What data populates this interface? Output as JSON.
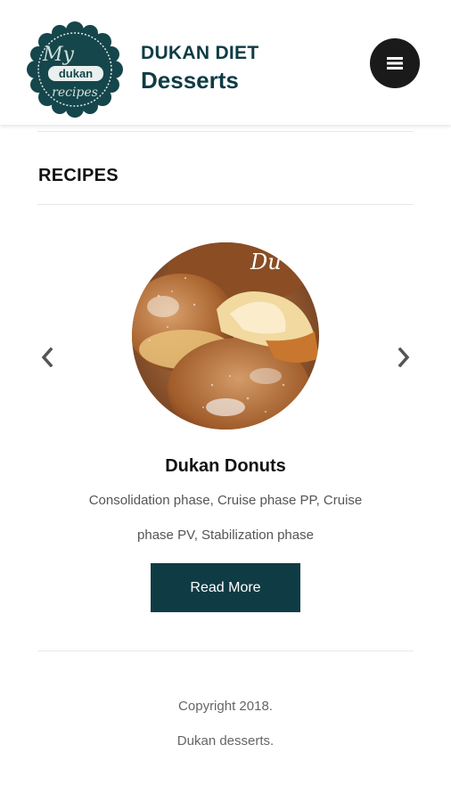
{
  "header": {
    "logo_text": [
      "My",
      "dukan",
      "recipes"
    ],
    "brand_line1": "DUKAN DIET",
    "brand_line2": "Desserts",
    "menu_icon": "hamburger-icon"
  },
  "section": {
    "title": "RECIPES"
  },
  "carousel": {
    "prev_icon": "chevron-left-icon",
    "next_icon": "chevron-right-icon",
    "current": {
      "image_caption": "Du",
      "title": "Dukan Donuts",
      "description": "Consolidation phase, Cruise phase PP, Cruise phase PV, Stabilization phase",
      "button_label": "Read More"
    }
  },
  "footer": {
    "copyright": "Copyright 2018.",
    "site_name": "Dukan desserts."
  },
  "colors": {
    "brand": "#0f3b45",
    "menu_button": "#1a1a1a",
    "text_muted": "#555555"
  }
}
